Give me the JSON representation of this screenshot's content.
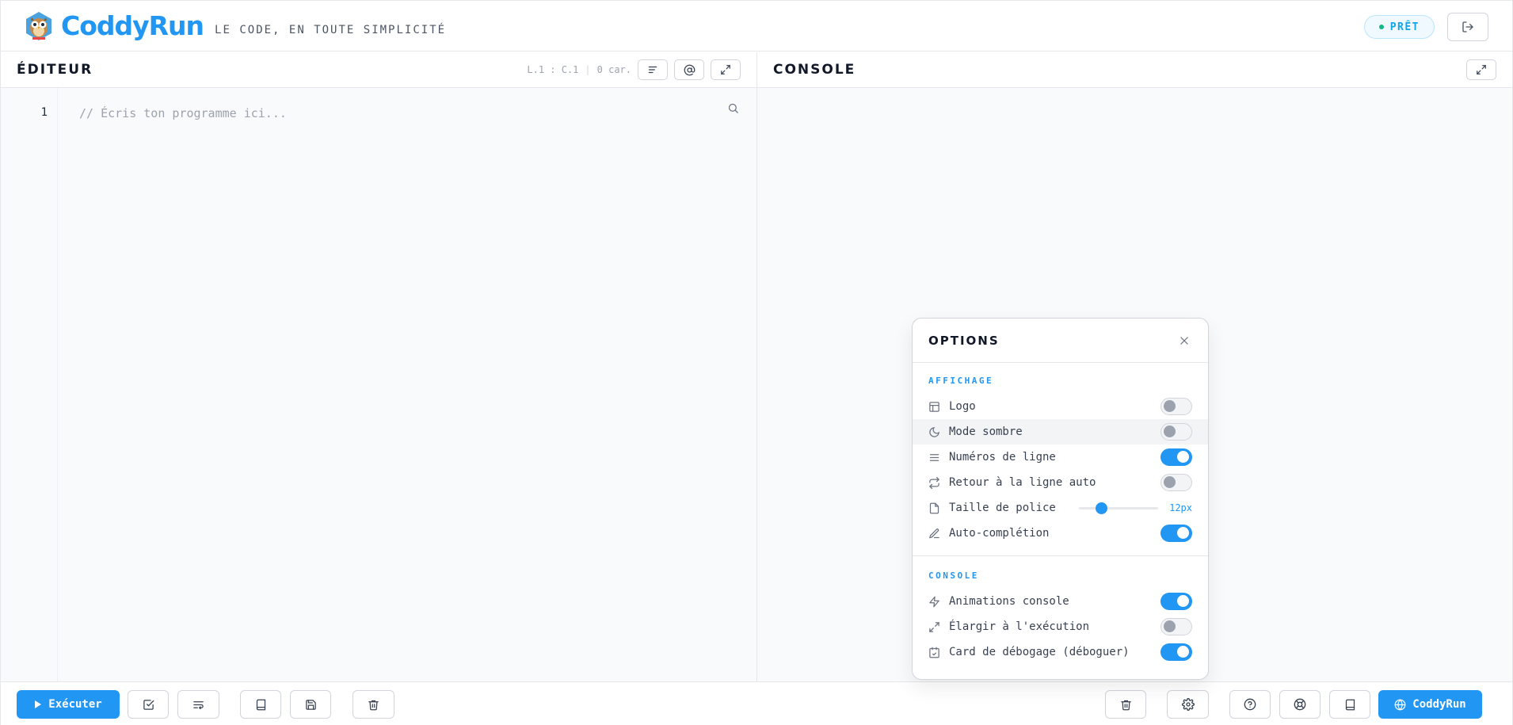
{
  "header": {
    "brand": "CoddyRun",
    "tagline": "LE CODE, EN TOUTE SIMPLICITÉ",
    "status": "PRÊT",
    "logout_icon": "logout-icon",
    "logo_icon": "owl-logo-icon"
  },
  "editor": {
    "title": "ÉDITEUR",
    "cursor": "L.1 : C.1",
    "chars": "0 car.",
    "line_number": "1",
    "placeholder": "// Écris ton programme ici...",
    "tools": [
      "align-left-icon",
      "at-sign-icon",
      "expand-icon"
    ]
  },
  "console": {
    "title": "CONSOLE"
  },
  "footer": {
    "run_label": "Exécuter",
    "brand_label": "CoddyRun"
  },
  "options": {
    "title": "OPTIONS",
    "display_section": "AFFICHAGE",
    "display_items": [
      {
        "label": "Logo",
        "icon": "layout-icon",
        "on": false
      },
      {
        "label": "Mode sombre",
        "icon": "moon-icon",
        "on": false
      },
      {
        "label": "Numéros de ligne",
        "icon": "lines-icon",
        "on": true
      },
      {
        "label": "Retour à la ligne auto",
        "icon": "repeat-icon",
        "on": false
      }
    ],
    "font_size": {
      "label": "Taille de police",
      "icon": "file-icon",
      "value": "12px",
      "level": 0.28
    },
    "autocomplete": {
      "label": "Auto-complétion",
      "icon": "pen-icon",
      "on": true
    },
    "console_section": "CONSOLE",
    "console_items": [
      {
        "label": "Animations console",
        "icon": "zap-icon",
        "on": true
      },
      {
        "label": "Élargir à l'exécution",
        "icon": "expand-icon",
        "on": false
      },
      {
        "label": "Card de débogage (déboguer)",
        "icon": "calendar-check-icon",
        "on": true
      }
    ]
  },
  "colors": {
    "accent": "#2196f3",
    "status_dot": "#10b981"
  }
}
